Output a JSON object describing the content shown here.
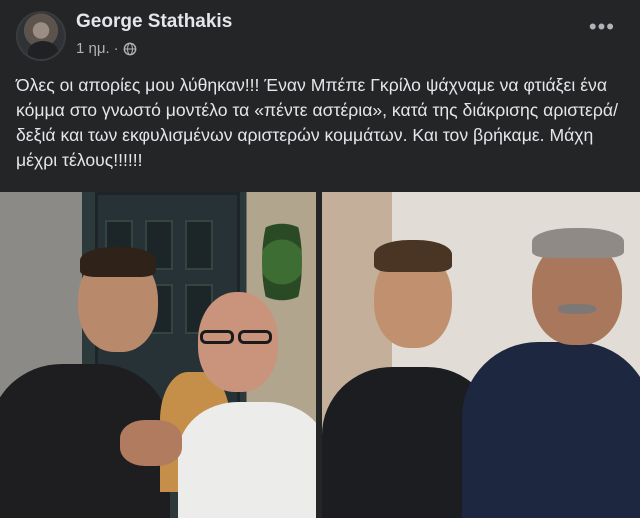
{
  "post": {
    "author": "George Stathakis",
    "time": "1 ημ.",
    "separator": "·",
    "privacy_icon": "globe-icon",
    "more_icon": "more-options-icon",
    "more_label": "•••",
    "text": "Όλες οι απορίες μου λύθηκαν!!! Έναν Μπέπε Γκρίλο ψάχναμε να φτιάξει ένα κόμμα στο γνωστό μοντέλο τα «πέντε αστέρια», κατά της διάκρισης αριστερά/δεξιά και των εκφυλισμένων αριστερών κομμάτων. Και τον βρήκαμε. Μάχη μέχρι τέλους!!!!!!"
  },
  "colors": {
    "background": "#242526",
    "primary_text": "#e4e6eb",
    "secondary_text": "#b0b3b8"
  },
  "photos": [
    {
      "name": "left-photo",
      "description_icon": "photo-icon"
    },
    {
      "name": "right-photo",
      "description_icon": "photo-icon"
    }
  ]
}
